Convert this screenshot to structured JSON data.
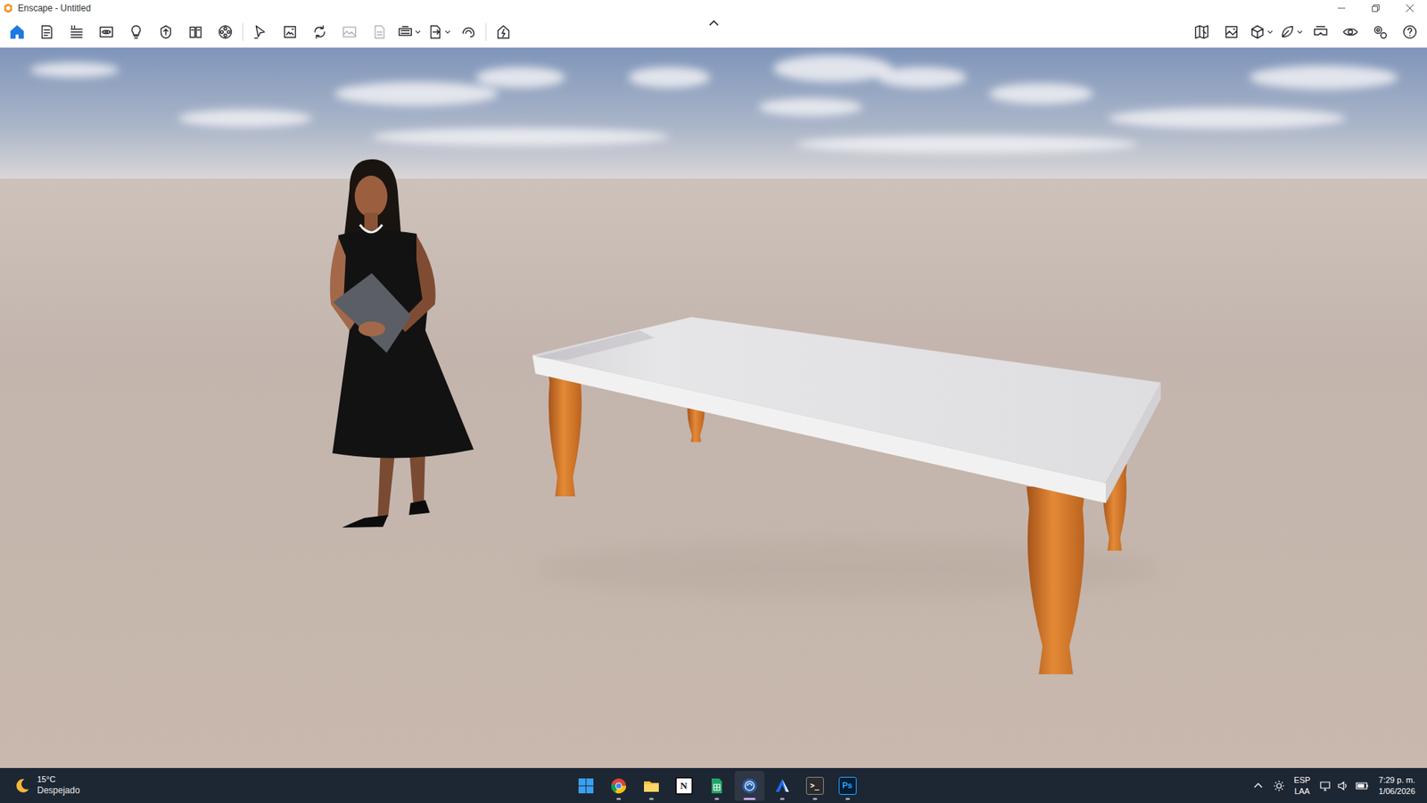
{
  "window": {
    "title": "Enscape - Untitled"
  },
  "toolbar": {
    "left_groups": [
      [
        {
          "selected": true,
          "disabled": false,
          "dropdown": false
        },
        {
          "selected": false,
          "disabled": false,
          "dropdown": false
        },
        {
          "selected": false,
          "disabled": false,
          "dropdown": false
        },
        {
          "selected": false,
          "disabled": false,
          "dropdown": false
        },
        {
          "selected": false,
          "disabled": false,
          "dropdown": false
        },
        {
          "selected": false,
          "disabled": false,
          "dropdown": false
        },
        {
          "selected": false,
          "disabled": false,
          "dropdown": false
        },
        {
          "selected": false,
          "disabled": false,
          "dropdown": false
        }
      ],
      [
        {
          "selected": false,
          "disabled": false,
          "dropdown": false
        },
        {
          "selected": false,
          "disabled": false,
          "dropdown": false
        },
        {
          "selected": false,
          "disabled": false,
          "dropdown": false
        },
        {
          "selected": false,
          "disabled": true,
          "dropdown": false
        },
        {
          "selected": false,
          "disabled": true,
          "dropdown": false
        },
        {
          "selected": false,
          "disabled": false,
          "dropdown": true
        },
        {
          "selected": false,
          "disabled": false,
          "dropdown": true
        },
        {
          "selected": false,
          "disabled": false,
          "dropdown": false
        }
      ],
      [
        {
          "selected": false,
          "disabled": false,
          "dropdown": false
        }
      ]
    ],
    "right": [
      {
        "selected": false,
        "disabled": false,
        "dropdown": false
      },
      {
        "selected": false,
        "disabled": false,
        "dropdown": false
      },
      {
        "selected": false,
        "disabled": false,
        "dropdown": true
      },
      {
        "selected": false,
        "disabled": false,
        "dropdown": true
      },
      {
        "selected": false,
        "disabled": false,
        "dropdown": false
      },
      {
        "selected": false,
        "disabled": false,
        "dropdown": false
      },
      {
        "selected": false,
        "disabled": false,
        "dropdown": false
      },
      {
        "selected": false,
        "disabled": false,
        "dropdown": false
      }
    ]
  },
  "taskbar": {
    "weather": {
      "temperature": "15°C",
      "condition": "Despejado"
    },
    "apps": [
      {
        "running": false,
        "active": false
      },
      {
        "running": true,
        "active": false
      },
      {
        "running": true,
        "active": false
      },
      {
        "glyph": "N",
        "running": false,
        "active": false
      },
      {
        "running": true,
        "active": false
      },
      {
        "running": true,
        "active": true
      },
      {
        "running": true,
        "active": false
      },
      {
        "glyph": ">_",
        "running": true,
        "active": false
      },
      {
        "glyph": "Ps",
        "running": true,
        "active": false
      }
    ],
    "tray": {
      "language": "ESP",
      "layout": "LAA",
      "time": "7:29 p. m.",
      "date": "1/06/2026"
    }
  }
}
